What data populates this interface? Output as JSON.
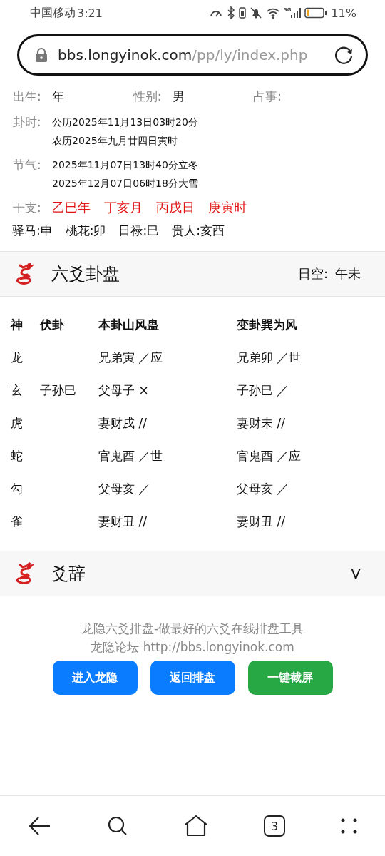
{
  "status_bar": {
    "carrier": "中国移动",
    "time": "3:21",
    "network": "5G",
    "battery_percent": "11%"
  },
  "address_bar": {
    "host": "bbs.longyinok.com",
    "path": "/pp/ly/index.php"
  },
  "info": {
    "fields": [
      {
        "label": "出生:",
        "value": "年"
      },
      {
        "label": "性别:",
        "value": "男"
      },
      {
        "label": "占事:"
      }
    ],
    "time": {
      "label": "卦时:",
      "lines": [
        "公历2025年11月13日03时20分",
        "农历2025年九月廿四日寅时"
      ]
    },
    "solar_terms": {
      "label": "节气:",
      "lines": [
        "2025年11月07日13时40分立冬",
        "2025年12月07日06时18分大雪"
      ]
    },
    "ganzhi": {
      "label": "干支:",
      "items": [
        "乙巳年",
        "丁亥月",
        "丙戌日",
        "庚寅时"
      ]
    },
    "stars": [
      "驿马:申",
      "桃花:卯",
      "日禄:巳",
      "贵人:亥酉"
    ]
  },
  "chart_panel": {
    "title": "六爻卦盘",
    "void_label": "日空:",
    "void_value": "午未",
    "columns": [
      "神",
      "伏卦",
      "本卦山风蛊",
      "变卦巽为风"
    ],
    "rows": [
      [
        "龙",
        "",
        "兄弟寅 ／应",
        "兄弟卯 ／世"
      ],
      [
        "玄",
        "子孙巳",
        "父母子 ×",
        "子孙巳 ／"
      ],
      [
        "虎",
        "",
        "妻财戌 //",
        "妻财未 //"
      ],
      [
        "蛇",
        "",
        "官鬼酉 ／世",
        "官鬼酉 ／应"
      ],
      [
        "勾",
        "",
        "父母亥 ／",
        "父母亥 ／"
      ],
      [
        "雀",
        "",
        "妻财丑 //",
        "妻财丑 //"
      ]
    ]
  },
  "text_panel": {
    "title": "爻辞",
    "toggle": "V",
    "expanded": false
  },
  "footer": {
    "lines": [
      "龙隐六爻排盘-做最好的六爻在线排盘工具",
      "龙隐论坛 http://bbs.longyinok.com"
    ],
    "buttons": [
      {
        "label": "进入龙隐",
        "kind": "primary"
      },
      {
        "label": "返回排盘",
        "kind": "primary"
      },
      {
        "label": "一键截屏",
        "kind": "success"
      }
    ]
  },
  "bottom_nav": {
    "tab_count": "3"
  }
}
